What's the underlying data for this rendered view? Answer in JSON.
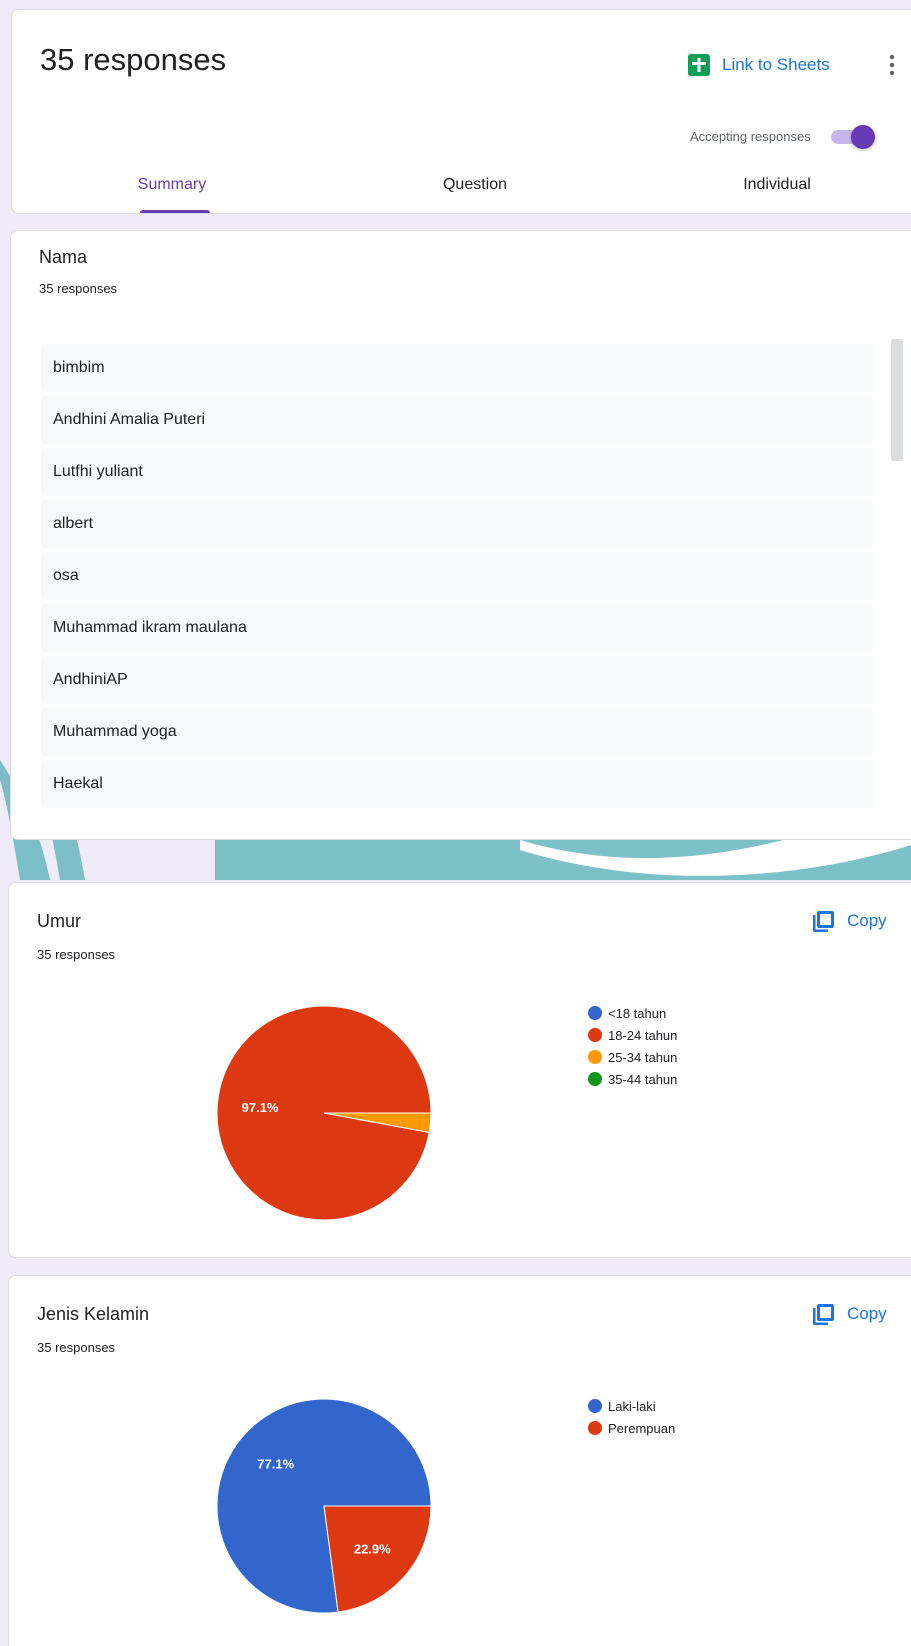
{
  "header": {
    "response_count": "35 responses",
    "sheets_link": "Link to Sheets",
    "accepting_label": "Accepting responses",
    "accepting": true,
    "tabs": [
      "Summary",
      "Question",
      "Individual"
    ],
    "active_tab": "Summary"
  },
  "colors": {
    "accent": "#673ab7",
    "link": "#1a73e8",
    "sheets_green": "#0f9d58",
    "series_blue": "#3366cc",
    "series_red": "#dc3912",
    "series_orange": "#ff9900",
    "series_green": "#109618"
  },
  "nama": {
    "title": "Nama",
    "count": "35 responses",
    "items": [
      "bimbim",
      "Andhini Amalia Puteri",
      "Lutfhi yuliant",
      "albert",
      "osa",
      "Muhammad ikram maulana",
      "AndhiniAP",
      "Muhammad yoga",
      "Haekal"
    ]
  },
  "umur": {
    "title": "Umur",
    "count": "35 responses",
    "copy_label": "Copy"
  },
  "jenis_kelamin": {
    "title": "Jenis Kelamin",
    "count": "35 responses",
    "copy_label": "Copy"
  },
  "chart_data": [
    {
      "type": "pie",
      "title": "Umur",
      "categories": [
        "<18 tahun",
        "18-24 tahun",
        "25-34 tahun",
        "35-44 tahun"
      ],
      "values": [
        0,
        97.1,
        2.9,
        0
      ],
      "labels": [
        "",
        "97.1%",
        "",
        ""
      ],
      "colors": [
        "#3366cc",
        "#dc3912",
        "#ff9900",
        "#109618"
      ],
      "legend_position": "right"
    },
    {
      "type": "pie",
      "title": "Jenis Kelamin",
      "categories": [
        "Laki-laki",
        "Perempuan"
      ],
      "values": [
        77.1,
        22.9
      ],
      "labels": [
        "77.1%",
        "22.9%"
      ],
      "colors": [
        "#3366cc",
        "#dc3912"
      ],
      "legend_position": "right"
    }
  ]
}
